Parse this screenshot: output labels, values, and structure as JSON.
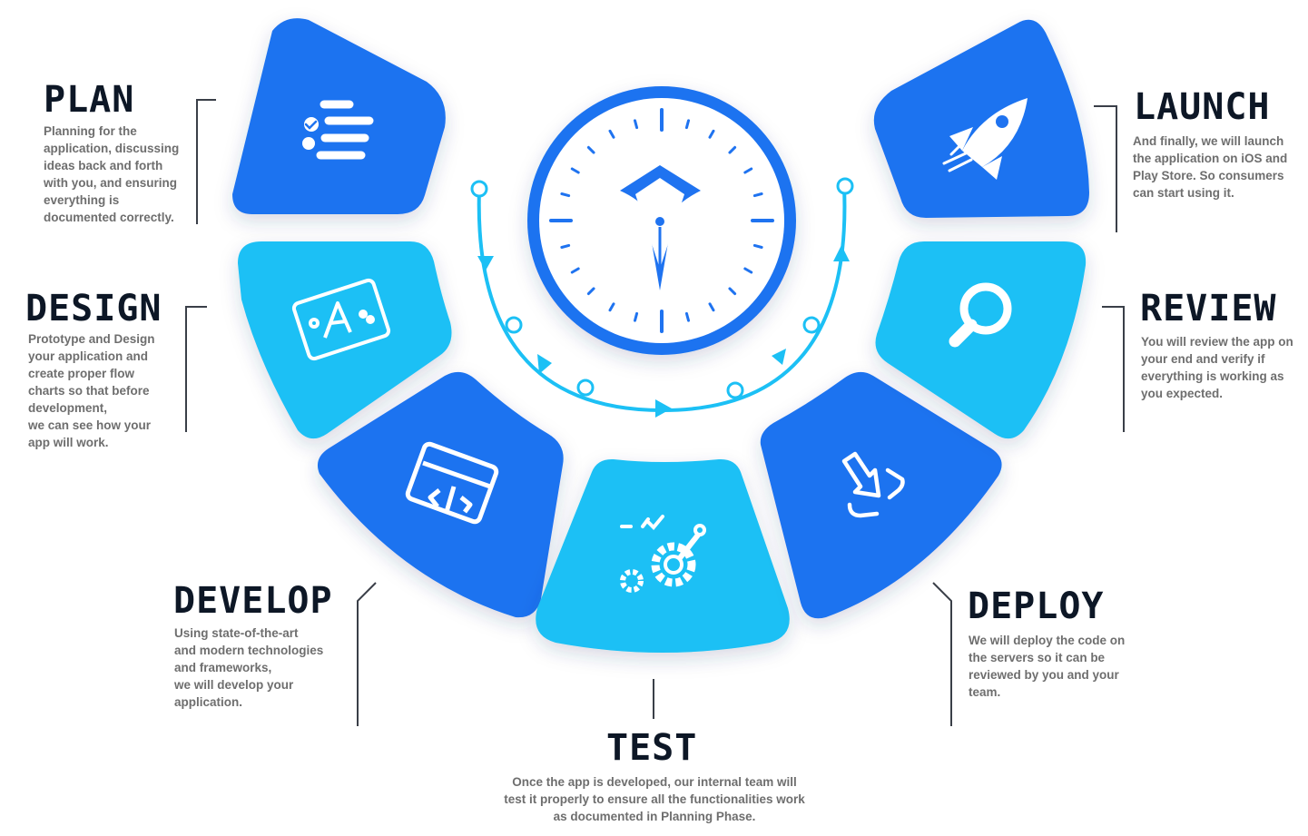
{
  "colors": {
    "dark_blue": "#1f73f0",
    "light_blue": "#1cc0f5",
    "text_dark": "#0d1726",
    "text_gray": "#6e6e6e",
    "line_gray": "#3a3f48"
  },
  "steps": [
    {
      "key": "plan",
      "title": "PLAN",
      "icon": "checklist-icon",
      "desc": "Planning for the\napplication, discussing\nideas back and forth\nwith you, and ensuring\neverything is\ndocumented correctly."
    },
    {
      "key": "design",
      "title": "DESIGN",
      "icon": "tablet-design-icon",
      "desc": "Prototype and Design\nyour application and\ncreate proper flow\ncharts so that before\ndevelopment,\nwe can see how your\napp will work."
    },
    {
      "key": "develop",
      "title": "DEVELOP",
      "icon": "code-window-icon",
      "desc": "Using state-of-the-art\nand modern technologies\nand frameworks,\nwe will develop your\napplication."
    },
    {
      "key": "test",
      "title": "TEST",
      "icon": "gears-check-icon",
      "desc": "Once the app is developed, our internal team will\ntest it properly to ensure all the functionalities work\nas documented in Planning Phase."
    },
    {
      "key": "deploy",
      "title": "DEPLOY",
      "icon": "deploy-arrow-icon",
      "desc": "We will deploy the code on\nthe servers so it can be\nreviewed by you and your\nteam."
    },
    {
      "key": "review",
      "title": "REVIEW",
      "icon": "magnifier-icon",
      "desc": "You will review the app on\nyour end and verify if\neverything is working as\nyou expected."
    },
    {
      "key": "launch",
      "title": "LAUNCH",
      "icon": "rocket-icon",
      "desc": "And finally, we will launch\nthe application on iOS and\nPlay Store. So consumers\ncan start using it."
    }
  ],
  "center": {
    "icon": "pen-nib-clock-icon"
  }
}
